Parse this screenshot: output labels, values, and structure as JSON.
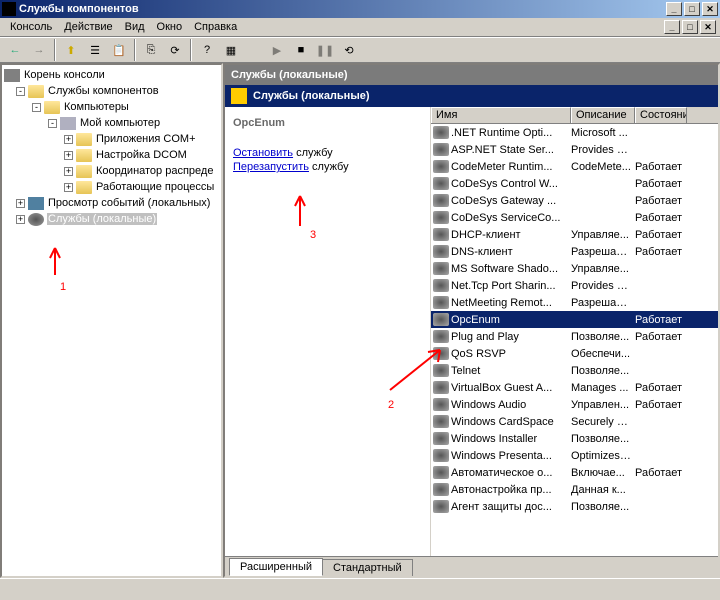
{
  "window": {
    "title": "Службы компонентов",
    "btns": {
      "min": "_",
      "max": "□",
      "close": "✕"
    }
  },
  "menu": {
    "console": "Консоль",
    "action": "Действие",
    "view": "Вид",
    "window": "Окно",
    "help": "Справка"
  },
  "toolbar_icons": {
    "back": "←",
    "fwd": "→",
    "up": "⬆",
    "props": "☰",
    "del": "✖",
    "export": "⎘",
    "refresh": "⟳",
    "help": "?",
    "play": "▶",
    "stop": "■",
    "pause": "❚❚",
    "restart": "⟲"
  },
  "tree": {
    "root": "Корень консоли",
    "compsvc": "Службы компонентов",
    "computers": "Компьютеры",
    "mycomp": "Мой компьютер",
    "complus": "Приложения COM+",
    "dcom": "Настройка DCOM",
    "coord": "Координатор распреде",
    "procs": "Работающие процессы",
    "eventlog": "Просмотр событий (локальных)",
    "services": "Службы (локальные)"
  },
  "header": {
    "main": "Службы (локальные)",
    "sub": "Службы (локальные)"
  },
  "detail": {
    "title": "OpcEnum",
    "stop_link": "Остановить",
    "stop_txt": " службу",
    "restart_link": "Перезапустить",
    "restart_txt": " службу"
  },
  "columns": {
    "name": "Имя",
    "desc": "Описание",
    "state": "Состояни"
  },
  "services": [
    {
      "name": ".NET Runtime Opti...",
      "desc": "Microsoft ...",
      "state": ""
    },
    {
      "name": "ASP.NET State Ser...",
      "desc": "Provides s...",
      "state": ""
    },
    {
      "name": "CodeMeter Runtim...",
      "desc": "CodeMete...",
      "state": "Работает"
    },
    {
      "name": "CoDeSys Control W...",
      "desc": "",
      "state": "Работает"
    },
    {
      "name": "CoDeSys Gateway ...",
      "desc": "",
      "state": "Работает"
    },
    {
      "name": "CoDeSys ServiceCo...",
      "desc": "",
      "state": "Работает"
    },
    {
      "name": "DHCP-клиент",
      "desc": "Управляе...",
      "state": "Работает"
    },
    {
      "name": "DNS-клиент",
      "desc": "Разрешае...",
      "state": "Работает"
    },
    {
      "name": "MS Software Shado...",
      "desc": "Управляе...",
      "state": ""
    },
    {
      "name": "Net.Tcp Port Sharin...",
      "desc": "Provides a...",
      "state": ""
    },
    {
      "name": "NetMeeting Remot...",
      "desc": "Разрешае...",
      "state": ""
    },
    {
      "name": "OpcEnum",
      "desc": "",
      "state": "Работает"
    },
    {
      "name": "Plug and Play",
      "desc": "Позволяе...",
      "state": "Работает"
    },
    {
      "name": "QoS RSVP",
      "desc": "Обеспечи...",
      "state": ""
    },
    {
      "name": "Telnet",
      "desc": "Позволяе...",
      "state": ""
    },
    {
      "name": "VirtualBox Guest A...",
      "desc": "Manages ...",
      "state": "Работает"
    },
    {
      "name": "Windows Audio",
      "desc": "Управлен...",
      "state": "Работает"
    },
    {
      "name": "Windows CardSpace",
      "desc": "Securely e...",
      "state": ""
    },
    {
      "name": "Windows Installer",
      "desc": "Позволяе...",
      "state": ""
    },
    {
      "name": "Windows Presenta...",
      "desc": "Optimizes ...",
      "state": ""
    },
    {
      "name": "Автоматическое о...",
      "desc": "Включае...",
      "state": "Работает"
    },
    {
      "name": "Автонастройка пр...",
      "desc": "Данная к...",
      "state": ""
    },
    {
      "name": "Агент защиты дос...",
      "desc": "Позволяе...",
      "state": ""
    }
  ],
  "tabs": {
    "extended": "Расширенный",
    "standard": "Стандартный"
  },
  "annotations": {
    "n1": "1",
    "n2": "2",
    "n3": "3"
  }
}
